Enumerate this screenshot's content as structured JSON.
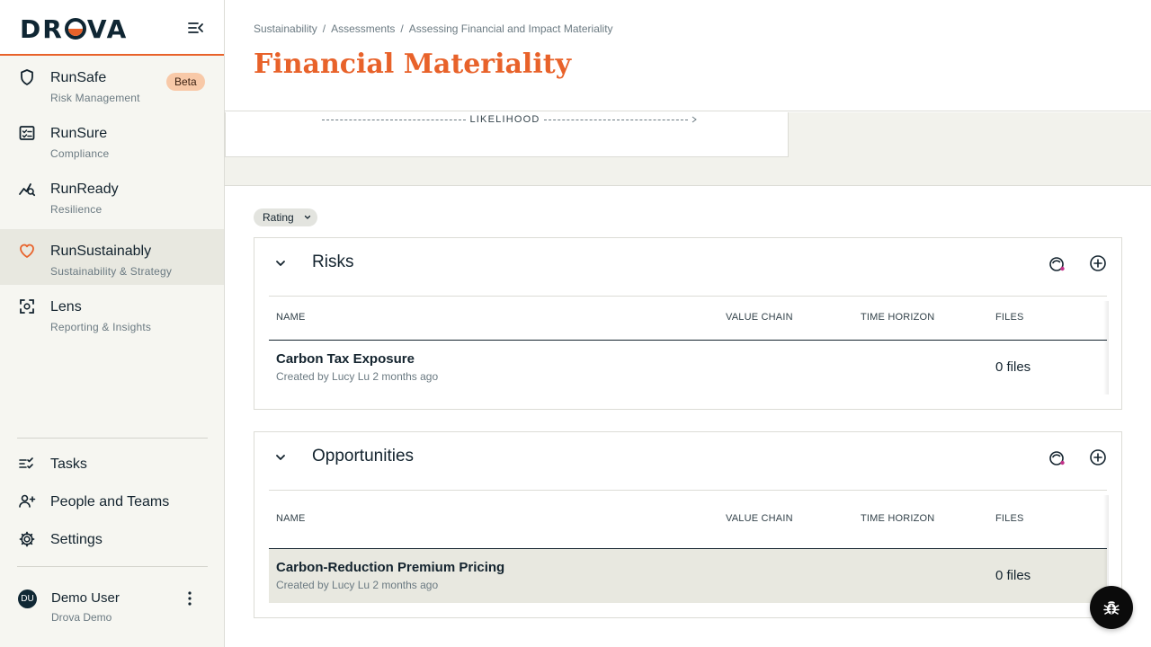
{
  "app": {
    "logo": "DROVA"
  },
  "sidebar": {
    "items": [
      {
        "title": "RunSafe",
        "subtitle": "Risk Management",
        "badge": "Beta",
        "icon": "shield-icon"
      },
      {
        "title": "RunSure",
        "subtitle": "Compliance",
        "icon": "checklist-icon"
      },
      {
        "title": "RunReady",
        "subtitle": "Resilience",
        "icon": "chart-search-icon"
      },
      {
        "title": "RunSustainably",
        "subtitle": "Sustainability & Strategy",
        "icon": "heart-icon",
        "active": true
      },
      {
        "title": "Lens",
        "subtitle": "Reporting & Insights",
        "icon": "scan-icon"
      }
    ],
    "bottom": [
      {
        "title": "Tasks",
        "icon": "tasks-icon"
      },
      {
        "title": "People and Teams",
        "icon": "people-add-icon"
      },
      {
        "title": "Settings",
        "icon": "gear-icon"
      }
    ],
    "user": {
      "initials": "DU",
      "name": "Demo User",
      "org": "Drova Demo"
    }
  },
  "header": {
    "breadcrumb": [
      "Sustainability",
      "Assessments",
      "Assessing Financial and Impact Materiality"
    ],
    "title": "Financial Materiality"
  },
  "chart": {
    "x_axis_label": "LIKELIHOOD"
  },
  "filter": {
    "label": "Rating"
  },
  "columns": {
    "name": "NAME",
    "value_chain": "VALUE CHAIN",
    "time_horizon": "TIME HORIZON",
    "files": "FILES"
  },
  "sections": [
    {
      "title": "Risks",
      "rows": [
        {
          "name": "Carbon Tax Exposure",
          "meta": "Created by Lucy Lu 2 months ago",
          "files": "0 files"
        }
      ]
    },
    {
      "title": "Opportunities",
      "rows": [
        {
          "name": "Carbon-Reduction Premium Pricing",
          "meta": "Created by Lucy Lu 2 months ago",
          "files": "0 files"
        }
      ]
    }
  ],
  "colors": {
    "accent": "#e8622a",
    "navy": "#0f2633",
    "sidebar_bg": "#f6f6f1"
  }
}
